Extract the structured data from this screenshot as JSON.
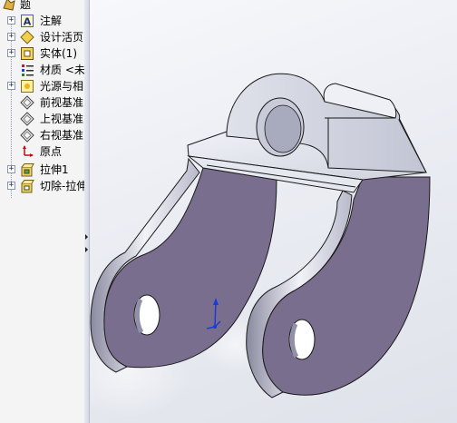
{
  "feature_tree": {
    "root_label": "题",
    "items": [
      {
        "label": "注解",
        "icon": "annotations-icon",
        "expandable": true
      },
      {
        "label": "设计活页",
        "icon": "design-binder-icon",
        "expandable": true
      },
      {
        "label": "实体(1)",
        "icon": "solid-bodies-icon",
        "expandable": true
      },
      {
        "label": "材质 <未",
        "icon": "material-icon",
        "expandable": false
      },
      {
        "label": "光源与相",
        "icon": "lights-cameras-icon",
        "expandable": true
      },
      {
        "label": "前视基准",
        "icon": "plane-icon",
        "expandable": false
      },
      {
        "label": "上视基准",
        "icon": "plane-icon",
        "expandable": false
      },
      {
        "label": "右视基准",
        "icon": "plane-icon",
        "expandable": false
      },
      {
        "label": "原点",
        "icon": "origin-icon",
        "expandable": false
      },
      {
        "label": "拉伸1",
        "icon": "extrude-feature-icon",
        "expandable": true
      },
      {
        "label": "切除-拉伸",
        "icon": "cut-extrude-feature-icon",
        "expandable": true
      }
    ]
  },
  "viewport": {
    "model": "bracket-part",
    "colors": {
      "face_purple": "#7a6e8e",
      "face_light": "#e2e4ec",
      "edge": "#1a1a1a",
      "triad_blue": "#1a3cd6"
    }
  }
}
